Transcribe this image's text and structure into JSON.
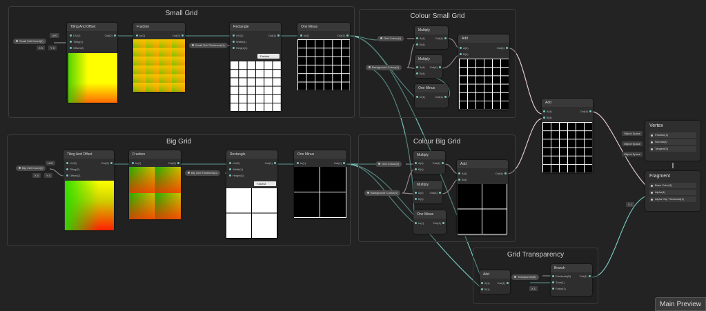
{
  "groups": {
    "small_grid": "Small Grid",
    "colour_small_grid": "Colour Small Grid",
    "big_grid": "Big Grid",
    "colour_big_grid": "Colour Big Grid",
    "grid_transparency": "Grid Transparency"
  },
  "nodes": {
    "tiling": "Tiling And Offset",
    "fraction": "Fraction",
    "rectangle": "Rectangle",
    "one_minus": "One Minus",
    "multiply": "Multiply",
    "add": "Add",
    "branch": "Branch"
  },
  "ports": {
    "uv_in": "UV(2)",
    "tiling_in": "Tiling(2)",
    "offset_in": "Offset(2)",
    "out2": "Out(2)",
    "in2": "In(2)",
    "in1": "In(1)",
    "out1": "Out(1)",
    "out4": "Out(4)",
    "in4": "In(4)",
    "width": "Width(1)",
    "height": "Height(1)",
    "a4": "A(4)",
    "b4": "B(4)",
    "a1": "A(1)",
    "b1": "B(1)",
    "predicate": "Predicate(B)",
    "true1": "True(1)",
    "false1": "False(1)"
  },
  "properties": {
    "small_cell_count": "Small Cell Count(1)",
    "small_grid_thickness": "Small Grid Thickness(1)",
    "big_cell_count": "Big Cell Count(1)",
    "big_grid_thickness": "Big Grid Thickness(1)",
    "grid_colour": "Grid Colour(4)",
    "background_colour": "Background Colour(4)",
    "transparent": "Transparent(B)"
  },
  "chips": {
    "uv0": "UV0",
    "x0": "X 0",
    "y0": "Y 0",
    "x1": "X 1",
    "fastest": "Fastest"
  },
  "master": {
    "vertex_title": "Vertex",
    "object_space": "Object Space",
    "position": "Position(3)",
    "normal": "Normal(3)",
    "tangent": "Tangent(3)",
    "fragment_title": "Fragment",
    "base_color": "Base Color(3)",
    "alpha": "Alpha(1)",
    "alpha_clip": "Alpha Clip Threshold(1)"
  },
  "main_preview": "Main Preview",
  "colors": {
    "wire": "#77c6bd",
    "wire_vec4": "#e3c5d0",
    "wire_gray": "#cfcfcf"
  }
}
